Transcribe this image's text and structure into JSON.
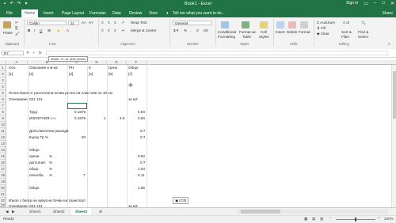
{
  "window": {
    "title": "Book1 - Excel",
    "sign_in": "Sign in"
  },
  "tabs": [
    "File",
    "Home",
    "Insert",
    "Page Layout",
    "Formulas",
    "Data",
    "Review",
    "View"
  ],
  "tell_me": "Tell me what you want to do...",
  "share": "Share",
  "ribbon": {
    "paste": "Paste",
    "font_name": "Calibri",
    "font_size": "11",
    "wrap_text": "Wrap Text",
    "merge_center": "Merge & Center",
    "number_format": "General",
    "conditional": "Conditional",
    "formatting": "Formatting",
    "format_as": "Format as",
    "table": "Table",
    "cell": "Cell",
    "styles": "Styles",
    "insert": "Insert",
    "delete": "Delete",
    "format": "Format",
    "autosum": "AutoSum",
    "fill": "Fill",
    "clear": "Clear",
    "sort_filter_1": "Sort &",
    "sort_filter_2": "Filter",
    "find_select_1": "Find &",
    "find_select_2": "Select",
    "groups": [
      "Clipboard",
      "Font",
      "Alignment",
      "Number",
      "Styles",
      "Cells",
      "Editing"
    ]
  },
  "formula_bar": {
    "name_box": "D7",
    "fx": "fx",
    "tooltip": "Width: 47.14 (335 pixels)"
  },
  "columns": [
    "A",
    "B",
    "C",
    "D",
    "E",
    "F"
  ],
  "rows": [
    "1",
    "2",
    "3",
    "4",
    "5",
    "6",
    "7",
    "8",
    "9",
    "10",
    "11",
    "12",
    "13",
    "14",
    "15",
    "16",
    "17",
    "18",
    "19",
    "20",
    "21",
    "22",
    "23"
  ],
  "cells": {
    "r1a": "Осн.",
    "r1b": "Описание и м-ка",
    "r1c": "РН",
    "r1d": "К",
    "r1e": "Цена",
    "r1f": "Общо",
    "r2a": "[1]",
    "r2b": "[2]",
    "r2c": "[3]",
    "r2d": "[4]",
    "r2e": "[6]",
    "r2f": "[7]",
    "r5a": "Почистване от разтителна почва ръчно на  пластове по 10 см.",
    "r6a": "Основание: 021 101",
    "r6f": "за м2",
    "r8b": "Труд",
    "r8c": "0.1875",
    "r8f": "0.84",
    "r9b": "ИЗКОПЧИЯ ч.ч.",
    "r9c": "0.1875",
    "r9d": "1",
    "r9e": "4.5",
    "r9f": "0.84",
    "r11b": "Допълнителни разходи",
    "r11f": "0.7",
    "r12b": "върху Тр %",
    "r12c": "83",
    "r12f": "0.7",
    "r14b": "Общо",
    "r15b": "преки",
    "r15bb": "%",
    "r15f": "0.84",
    "r16b": "допълнит.",
    "r16bb": "%",
    "r16f": "0.7",
    "r17b": "общо",
    "r17bb": "%",
    "r17f": "1.54",
    "r18b": "печалба",
    "r18bb": "%",
    "r18c": "7",
    "r18f": "0.11",
    "r20b": "Общо",
    "r20f": "1.65",
    "r22a": "Изкоп с багер на хумусни почви на транспорт",
    "r23a": "Основание: 021 101",
    "r23f": "за м3"
  },
  "paste_options": "(Ctrl)",
  "sheets": [
    "Sheet1",
    "Sheet2",
    "Sheet3"
  ],
  "active_sheet": "Sheet3",
  "status": {
    "ready": "Ready",
    "zoom": "100%"
  },
  "colors": {
    "excel_green": "#217346",
    "selection": "#217346"
  }
}
